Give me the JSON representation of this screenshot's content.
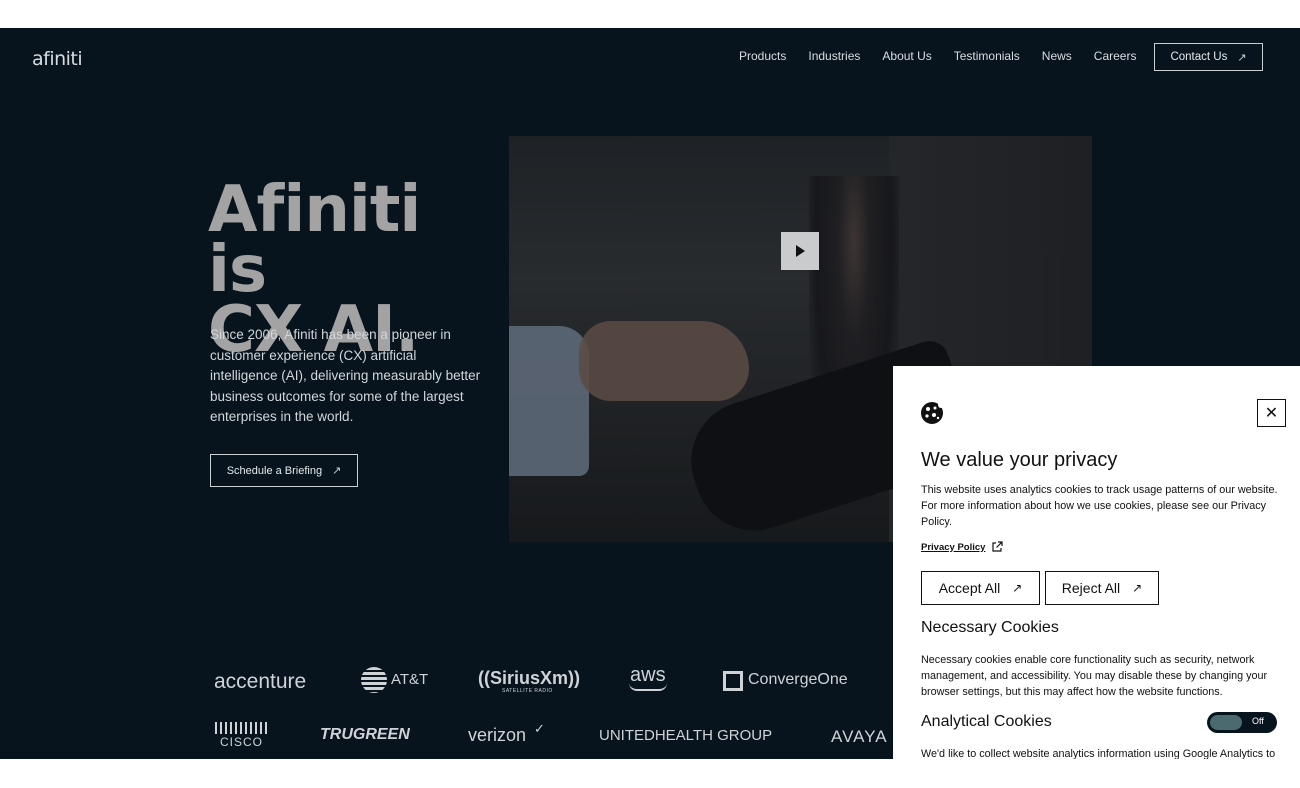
{
  "header": {
    "logo": "afiniti",
    "nav": [
      "Products",
      "Industries",
      "About Us",
      "Testimonials",
      "News",
      "Careers"
    ],
    "contact_label": "Contact Us"
  },
  "hero": {
    "title_line1": "Afiniti is",
    "title_line2": "CX AI.",
    "description": "Since 2006, Afiniti has been a pioneer in customer experience (CX) artificial intelligence (AI), delivering measurably better business outcomes for some of the largest enterprises in the world.",
    "cta_label": "Schedule a Briefing",
    "video_play_icon": "play-icon"
  },
  "clients": {
    "row1": [
      "accenture",
      "AT&T",
      "((SiriusXm))",
      "SATELLITE RADIO",
      "aws",
      "ConvergeOne"
    ],
    "row2": [
      "CISCO",
      "TRUGREEN",
      "verizon",
      "UNITEDHEALTH GROUP",
      "AVAYA"
    ]
  },
  "cookie_banner": {
    "title": "We value your privacy",
    "text": "This website uses analytics cookies to track usage patterns of our website. For more information about how we use cookies, please see our Privacy Policy.",
    "privacy_link": "Privacy Policy",
    "accept_label": "Accept All",
    "reject_label": "Reject All",
    "necessary_title": "Necessary Cookies",
    "necessary_text": "Necessary cookies enable core functionality such as security, network management, and accessibility. You may disable these by changing your browser settings, but this may affect how the website functions.",
    "analytical_title": "Analytical Cookies",
    "analytical_toggle": "Off",
    "analytical_text": "We'd like to collect website analytics information using Google Analytics to"
  },
  "colors": {
    "page_bg": "#07141e",
    "title_gray": "#a3a3a3",
    "text_light": "#d2d6d9",
    "cookie_bg": "#ffffff"
  }
}
